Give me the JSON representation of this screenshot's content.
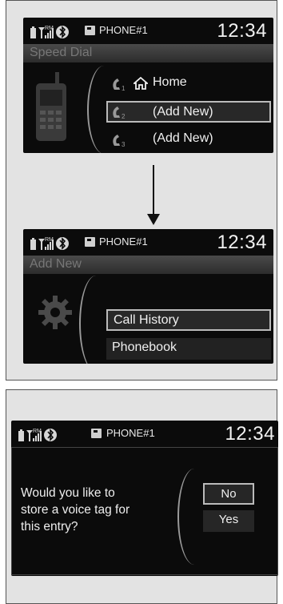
{
  "status": {
    "phone_name": "PHONE#1",
    "time": "12:34",
    "rm_label": "RM"
  },
  "screen1": {
    "title": "Speed Dial",
    "items": [
      {
        "index": "1",
        "label": "Home"
      },
      {
        "index": "2",
        "label": "(Add New)"
      },
      {
        "index": "3",
        "label": "(Add New)"
      }
    ]
  },
  "screen2": {
    "title": "Add New",
    "items": [
      {
        "label": "Call History"
      },
      {
        "label": "Phonebook"
      }
    ]
  },
  "screen3": {
    "prompt_line1": "Would you like to",
    "prompt_line2": "store a voice tag for",
    "prompt_line3": "this entry?",
    "buttons": [
      {
        "label": "No"
      },
      {
        "label": "Yes"
      }
    ]
  },
  "colors": {
    "screen_bg": "#0b0b0b",
    "panel_bg": "#e3e3e3",
    "highlight_border": "#bbbbbb"
  }
}
